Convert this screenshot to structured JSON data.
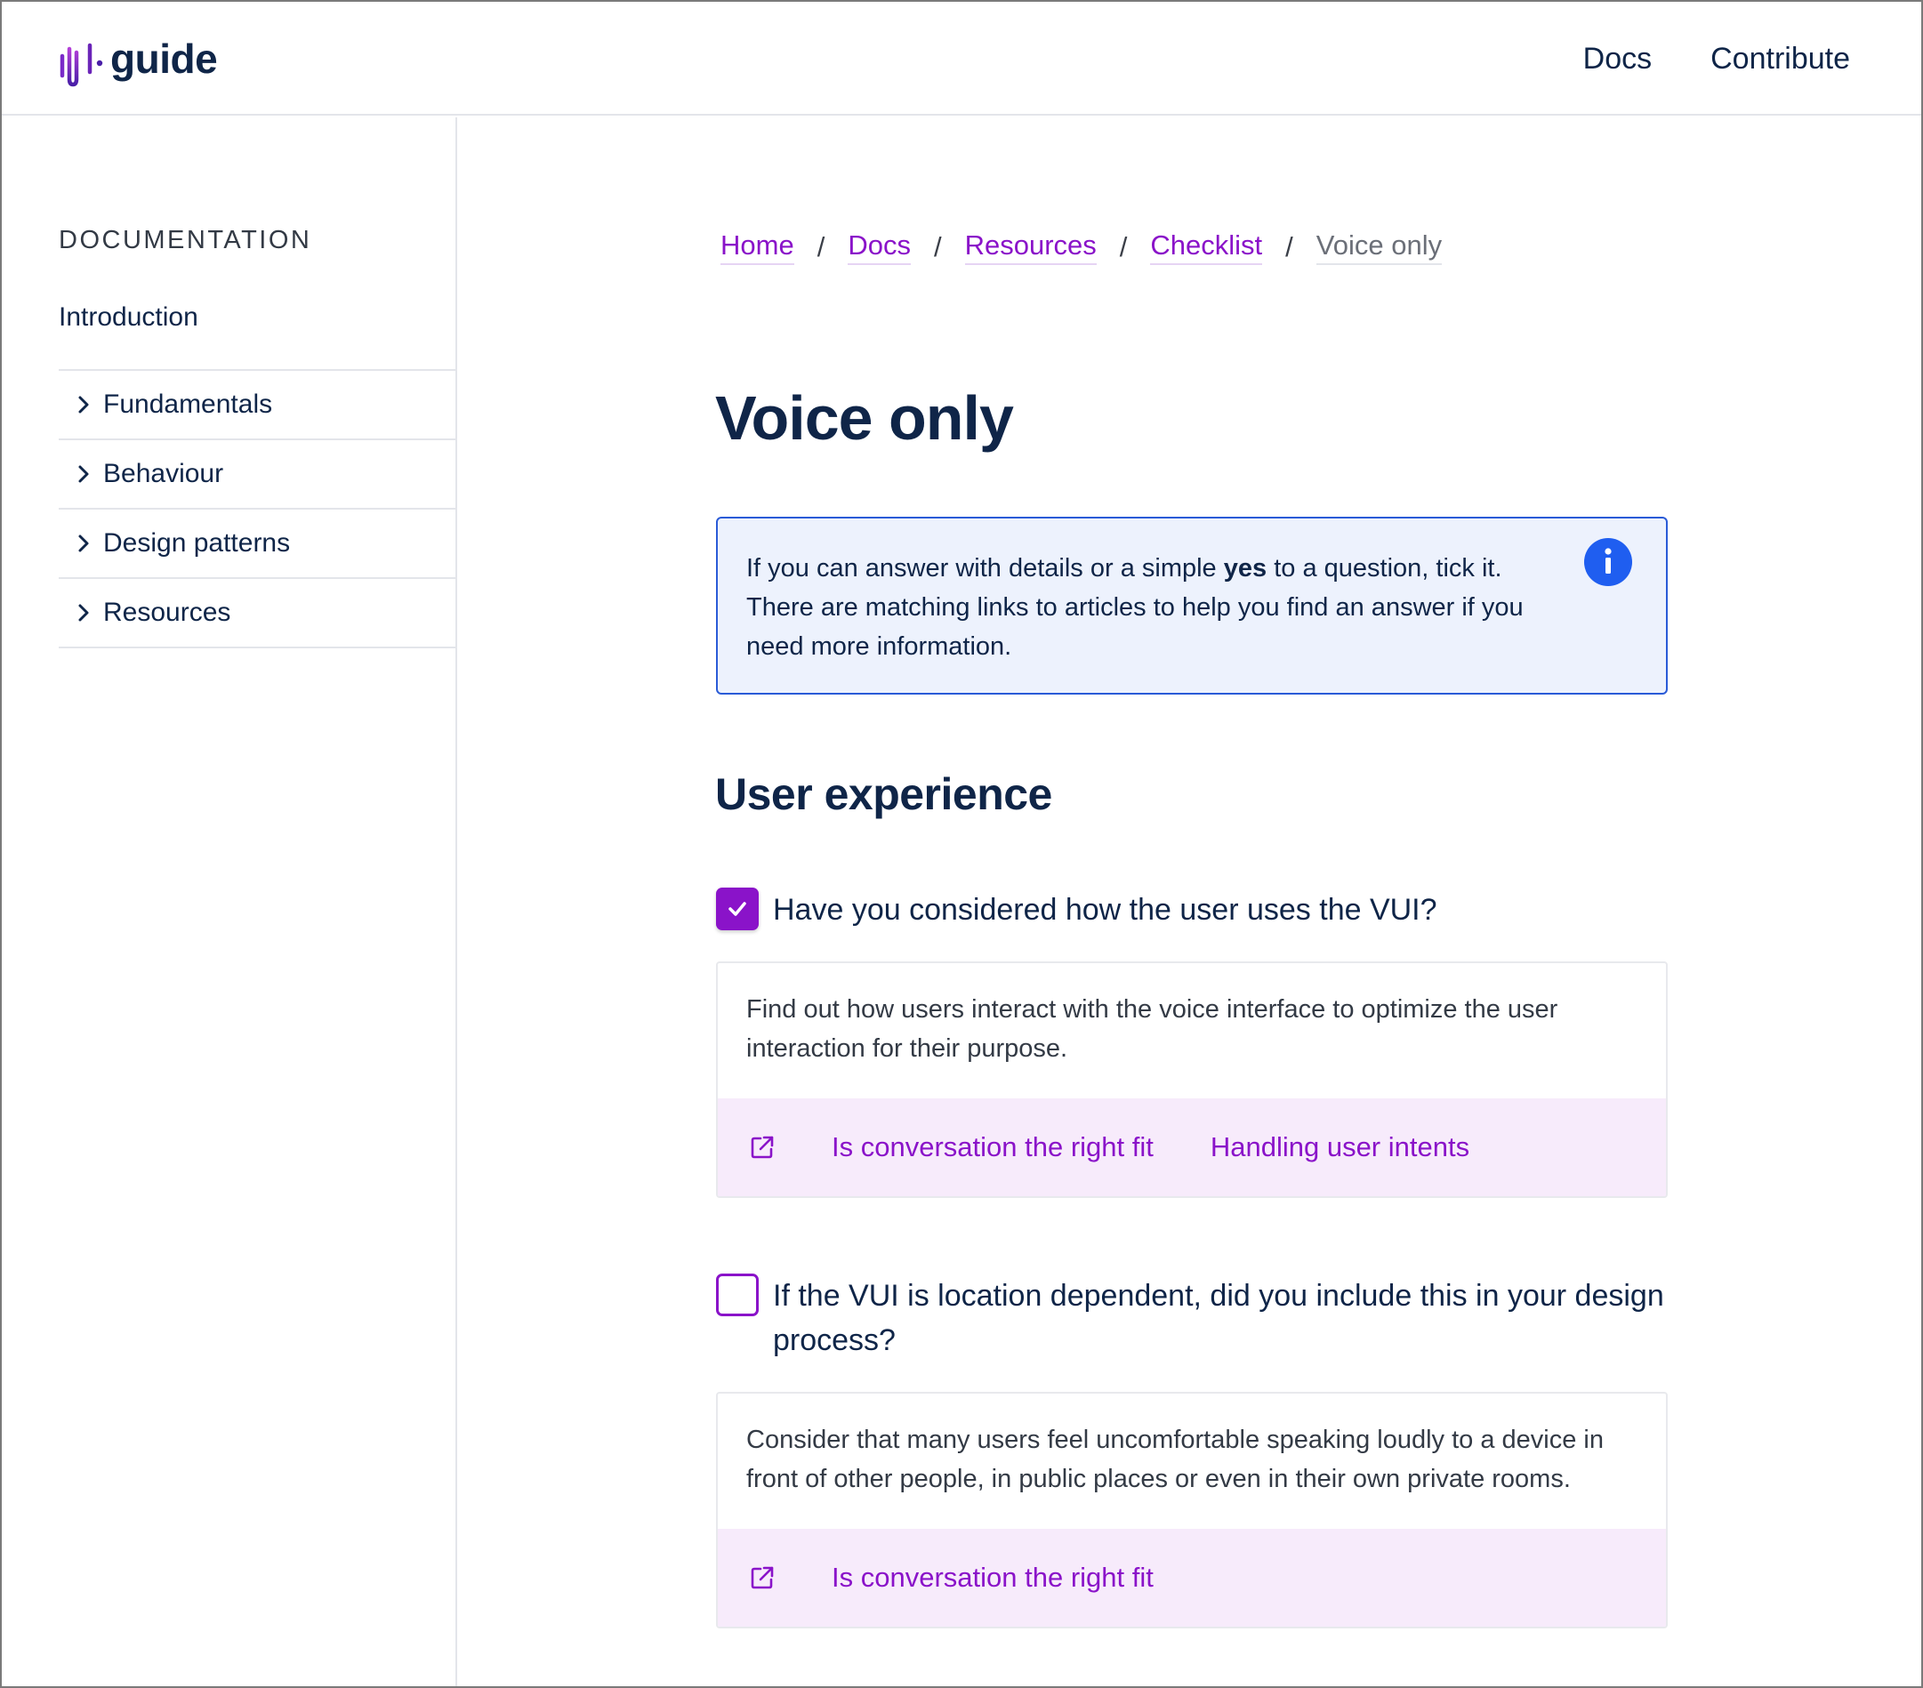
{
  "brand": {
    "logo_text": "guide",
    "accent": "#8a13c9",
    "text_dark": "#0f2548"
  },
  "topnav": {
    "docs": "Docs",
    "contribute": "Contribute"
  },
  "sidebar": {
    "heading": "DOCUMENTATION",
    "intro": "Introduction",
    "items": [
      {
        "label": "Fundamentals",
        "icon": "chevron-right-icon"
      },
      {
        "label": "Behaviour",
        "icon": "chevron-right-icon"
      },
      {
        "label": "Design patterns",
        "icon": "chevron-right-icon"
      },
      {
        "label": "Resources",
        "icon": "chevron-right-icon"
      }
    ]
  },
  "breadcrumb": {
    "items": [
      "Home",
      "Docs",
      "Resources",
      "Checklist"
    ],
    "separator": "/",
    "current": "Voice only"
  },
  "page": {
    "title": "Voice only",
    "info": {
      "text_before": "If you can answer with details or a simple ",
      "bold": "yes",
      "text_after": " to a question, tick it. There are matching links to articles to help you find an answer if you need more information.",
      "icon": "info-icon",
      "color": "#1f5ef0"
    },
    "section_title": "User experience",
    "checklist": [
      {
        "question": "Have you considered how the user uses the VUI?",
        "checked": true,
        "description": "Find out how users interact with the voice interface to optimize the user interaction for their purpose.",
        "links": [
          "Is conversation the right fit",
          "Handling user intents"
        ]
      },
      {
        "question": "If the VUI is location dependent, did you include this in your design process?",
        "checked": false,
        "description": "Consider that many users feel uncomfortable speaking loudly to a device in front of other people, in public places or even in their own private rooms.",
        "links": [
          "Is conversation the right fit"
        ]
      }
    ]
  }
}
